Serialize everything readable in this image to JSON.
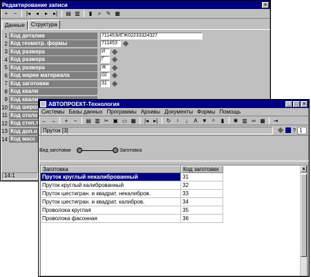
{
  "back_window": {
    "title": "Редактирование записи",
    "tabs": [
      "Данные",
      "Структура"
    ],
    "fields": [
      {
        "num": "1",
        "label": "Код деталии",
        "value": "711453ИГЖ02233324327"
      },
      {
        "num": "2",
        "label": "Код геометр. формы",
        "value": "711453"
      },
      {
        "num": "3",
        "label": "Код размера",
        "value": "И"
      },
      {
        "num": "4",
        "label": "Код размера",
        "value": "Г"
      },
      {
        "num": "5",
        "label": "Код размера",
        "value": "Ж"
      },
      {
        "num": "6",
        "label": "Код марки материала",
        "value": "02"
      },
      {
        "num": "7",
        "label": "Код заготовки",
        "value": "31"
      },
      {
        "num": "8",
        "label": "Код квали",
        "value": ""
      },
      {
        "num": "9",
        "label": "Код квали",
        "value": ""
      },
      {
        "num": "10",
        "label": "Код шерох",
        "value": ""
      },
      {
        "num": "11",
        "label": "Код откло",
        "value": ""
      },
      {
        "num": "12",
        "label": "Код степ.т",
        "value": ""
      },
      {
        "num": "13",
        "label": "Код доп.о",
        "value": ""
      },
      {
        "num": "14",
        "label": "Код масс",
        "value": ""
      }
    ],
    "status": "14:1"
  },
  "front_window": {
    "title": "АВТОПРОЕКТ-Технология",
    "menu": [
      "Системы",
      "Базы данных",
      "Программы",
      "Архивы",
      "Документы",
      "Формы",
      "Помощь"
    ],
    "path_label": "Пруток [3]",
    "page_number": "1",
    "breadcrumb": [
      "Вид заготовки",
      "Заготовка"
    ],
    "table": {
      "headers": [
        "Заготовка",
        "Код заготовки"
      ],
      "rows": [
        [
          "Пруток круглый некалиброванный",
          "31"
        ],
        [
          "Пруток круглый калиброванный",
          "32"
        ],
        [
          "Пруток шестигран. и квадрат. некалибров.",
          "33"
        ],
        [
          "Пруток шестигран. и квадрат. калибров.",
          "34"
        ],
        [
          "Проволока круглая",
          "35"
        ],
        [
          "Проволока фасонная",
          "36"
        ]
      ]
    }
  },
  "colors": {
    "titlebar": "#000080",
    "face": "#c0c0c0",
    "label_bg": "#808080",
    "selection": "#000080"
  }
}
